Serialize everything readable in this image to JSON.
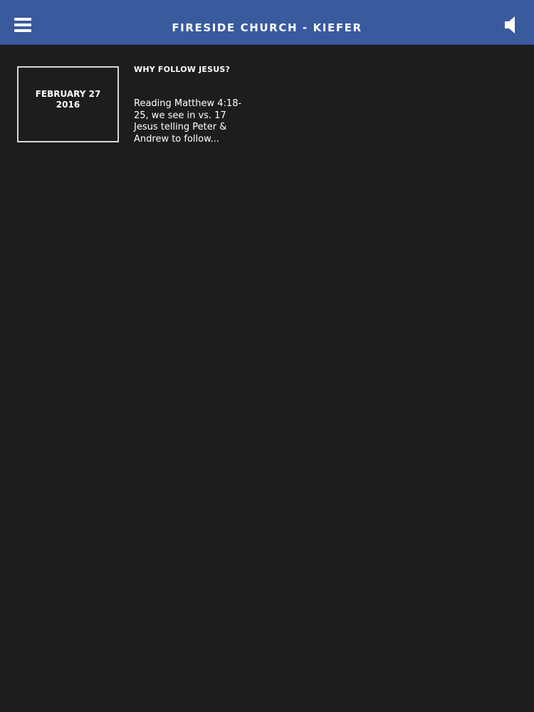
{
  "header": {
    "title": "FIRESIDE CHURCH - KIEFER",
    "menu_icon": "hamburger-menu-icon",
    "speaker_icon": "speaker-icon"
  },
  "sermons": [
    {
      "date_line1": "FEBRUARY 27",
      "date_line2": "2016",
      "title": "WHY FOLLOW JESUS?",
      "excerpt": "Reading Matthew 4:18-\n25, we see in vs. 17\nJesus telling Peter &\nAndrew to follow..."
    }
  ],
  "colors": {
    "header_bg": "#3a5a9e",
    "page_bg": "#1e1d1e",
    "text": "#ffffff",
    "date_border": "#d7d7d7"
  }
}
